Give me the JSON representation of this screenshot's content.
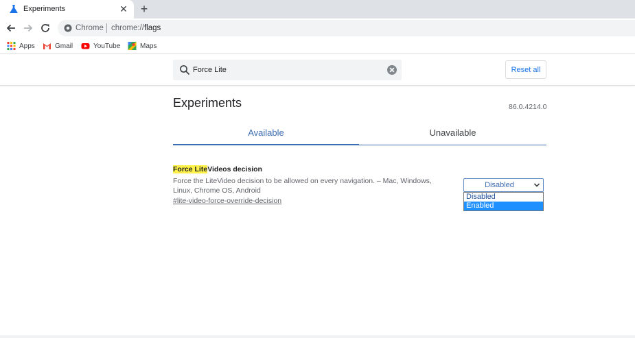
{
  "browser": {
    "tab_title": "Experiments",
    "tab_close_glyph": "✕",
    "new_tab_glyph": "+",
    "omnibox_site": "Chrome",
    "omnibox_scheme": "chrome://",
    "omnibox_path": "flags"
  },
  "bookmarks": [
    {
      "label": "Apps",
      "icon": "apps-grid-icon"
    },
    {
      "label": "Gmail",
      "icon": "gmail-icon"
    },
    {
      "label": "YouTube",
      "icon": "youtube-icon"
    },
    {
      "label": "Maps",
      "icon": "maps-icon"
    }
  ],
  "flags_header": {
    "search_value": "Force Lite",
    "reset_label": "Reset all"
  },
  "page": {
    "title": "Experiments",
    "version": "86.0.4214.0",
    "tabs": [
      {
        "label": "Available",
        "active": true
      },
      {
        "label": "Unavailable",
        "active": false
      }
    ]
  },
  "experiment": {
    "title_highlight": "Force Lite",
    "title_rest": "Videos decision",
    "description": "Force the LiteVideo decision to be allowed on every navigation. – Mac, Windows, Linux, Chrome OS, Android",
    "link": "#lite-video-force-override-decision",
    "selected": "Disabled",
    "options": [
      "Disabled",
      "Enabled"
    ],
    "highlighted_option": "Enabled"
  },
  "colors": {
    "accent": "#3c6cb2",
    "highlight": "#fff14a",
    "option_selected_bg": "#1e90ff"
  }
}
